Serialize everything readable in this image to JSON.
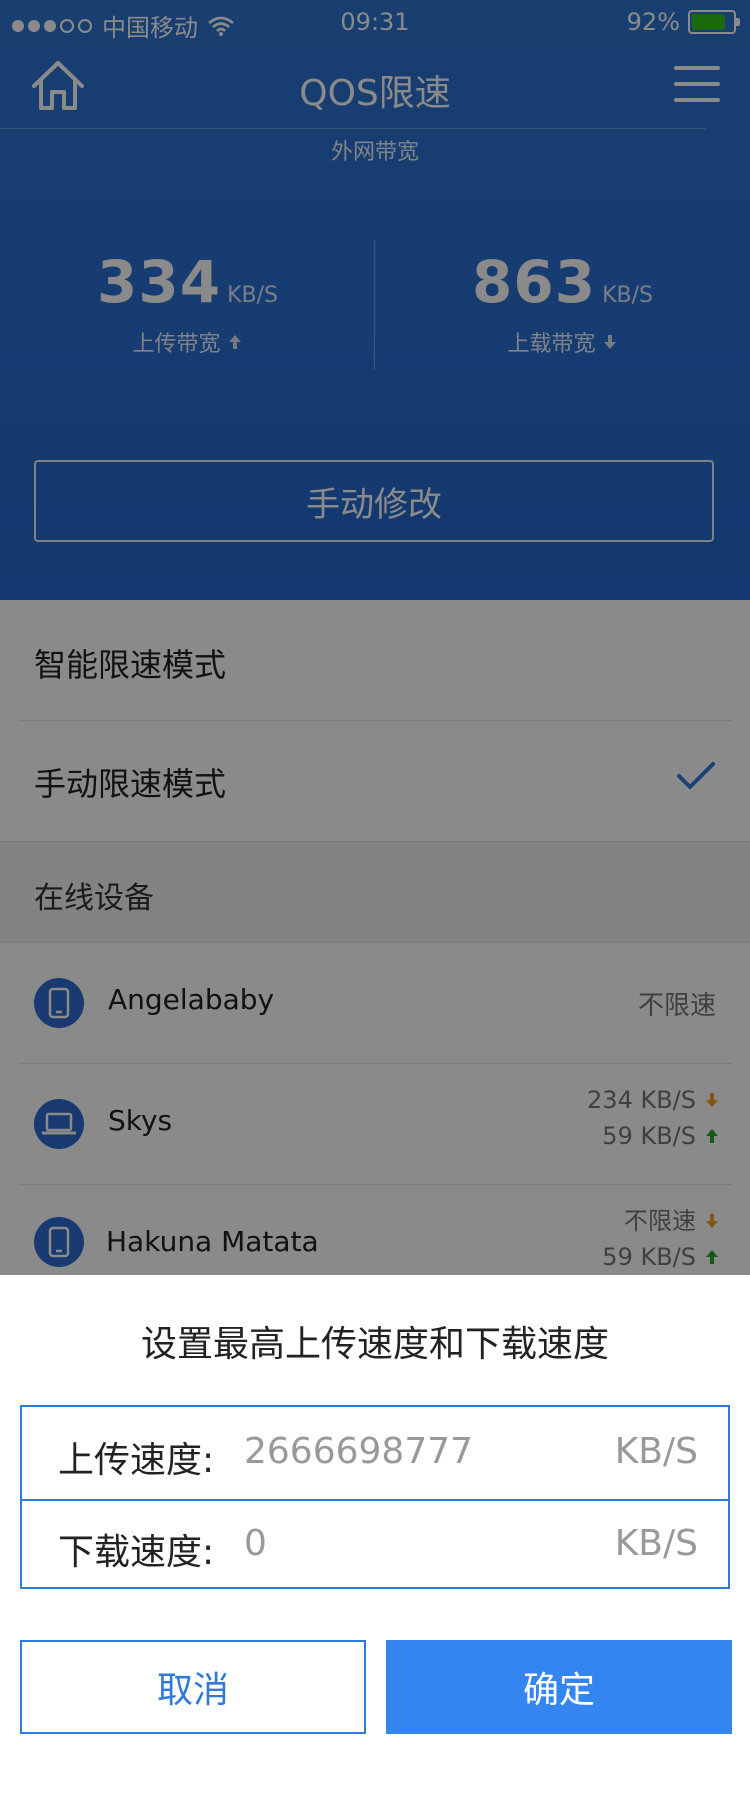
{
  "status_bar": {
    "carrier": "中国移动",
    "time": "09:31",
    "battery": "92%",
    "battery_level": 0.92
  },
  "nav": {
    "title": "QOS限速",
    "home_icon": "home-icon",
    "menu_icon": "menu-icon"
  },
  "bandwidth": {
    "section_title": "外网带宽",
    "upload": {
      "value": "334",
      "unit": "KB/S",
      "label": "上传带宽"
    },
    "download": {
      "value": "863",
      "unit": "KB/S",
      "label": "上载带宽"
    },
    "manual_button": "手动修改"
  },
  "modes": {
    "smart": "智能限速模式",
    "manual": "手动限速模式",
    "selected": "manual"
  },
  "devices_section": "在线设备",
  "devices": [
    {
      "name": "Angelababy",
      "icon": "phone-icon",
      "status": "不限速"
    },
    {
      "name": "Skys",
      "icon": "laptop-icon",
      "down": "234 KB/S",
      "up": "59 KB/S"
    },
    {
      "name": "Hakuna Matata",
      "icon": "phone-icon",
      "down": "不限速",
      "up": "59 KB/S"
    }
  ],
  "dialog": {
    "title": "设置最高上传速度和下载速度",
    "upload_label": "上传速度:",
    "upload_value": "2666698777",
    "download_label": "下载速度:",
    "download_value": "0",
    "unit": "KB/S",
    "cancel": "取消",
    "confirm": "确定"
  },
  "colors": {
    "header_blue": "#2a6fd2",
    "accent": "#3485f0",
    "down_arrow": "#f0a020",
    "up_arrow": "#2aa52a"
  }
}
